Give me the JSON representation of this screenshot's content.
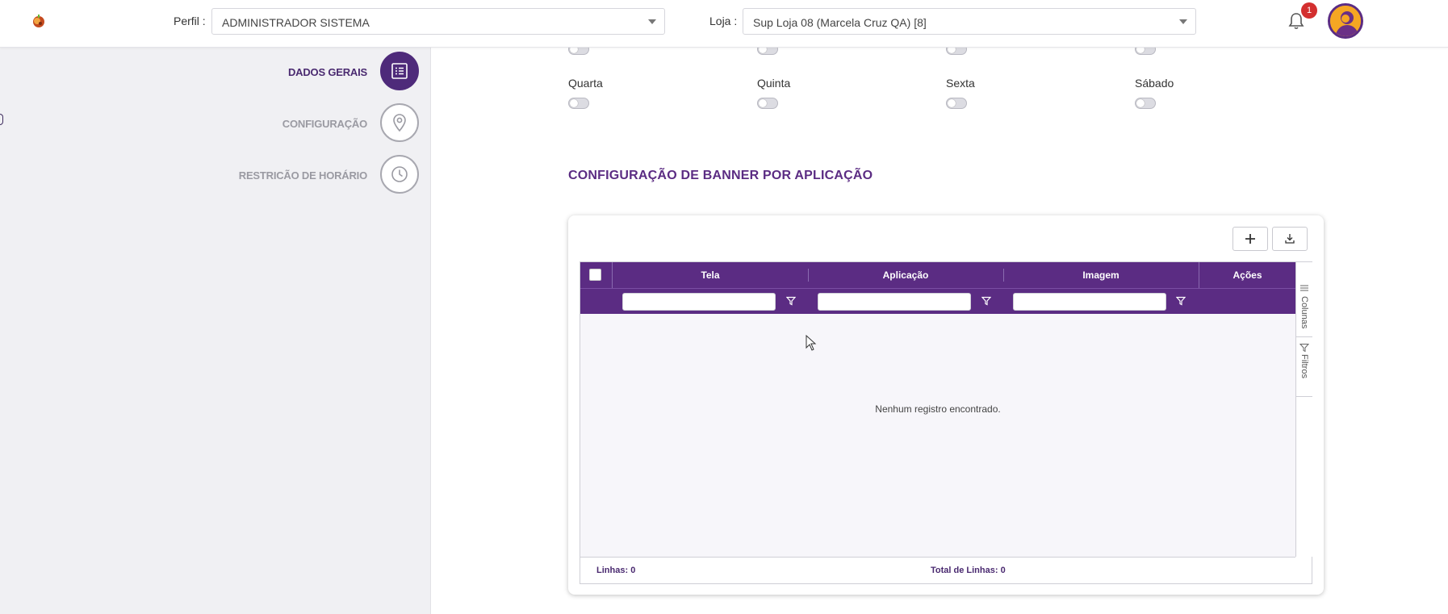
{
  "header": {
    "perfil_label": "Perfil",
    "perfil_value": "ADMINISTRADOR SISTEMA",
    "loja_label": "Loja",
    "loja_value": "Sup Loja 08 (Marcela Cruz QA) [8]",
    "notification_count": "1"
  },
  "steps": [
    {
      "label": "DADOS GERAIS",
      "icon": "list-icon",
      "active": true
    },
    {
      "label": "CONFIGURAÇÃO",
      "icon": "location-pin-icon",
      "active": false
    },
    {
      "label": "RESTRICÃO DE HORÁRIO",
      "icon": "clock-icon",
      "active": false
    }
  ],
  "days": {
    "labels": [
      "Quarta",
      "Quinta",
      "Sexta",
      "Sábado"
    ]
  },
  "banner_section": {
    "title": "CONFIGURAÇÃO DE BANNER POR APLICAÇÃO",
    "columns": [
      "Tela",
      "Aplicação",
      "Imagem",
      "Ações"
    ],
    "empty_message": "Nenhum registro encontrado.",
    "side_tabs": [
      "Colunas",
      "Filtros"
    ],
    "footer": {
      "rows_label": "Linhas:",
      "rows_value": "0",
      "total_label": "Total de Linhas:",
      "total_value": "0"
    }
  },
  "colors": {
    "primary": "#5b2c83",
    "primary_dark": "#4e2a7a",
    "sidebar_bg": "#f0f0f3",
    "badge": "#d32f2f"
  }
}
